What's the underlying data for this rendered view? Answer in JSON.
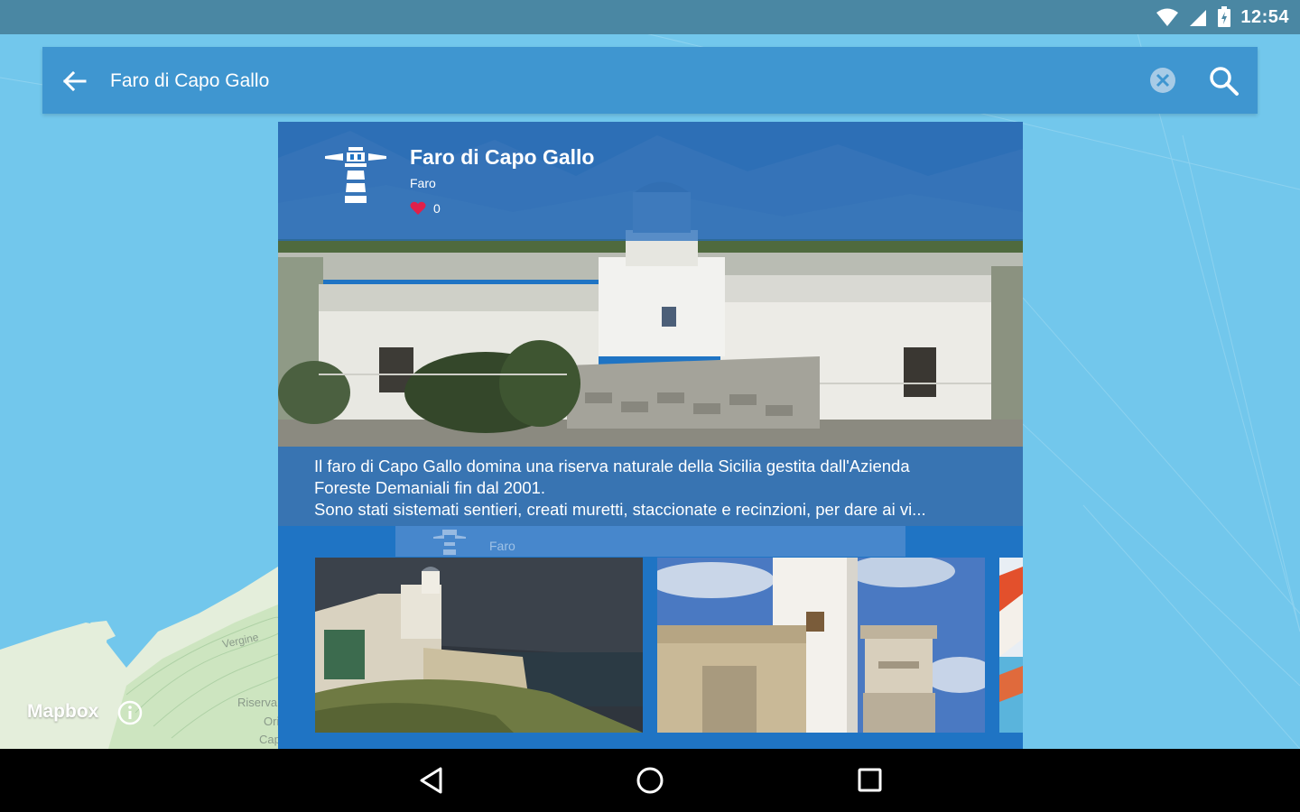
{
  "status_bar": {
    "time": "12:54",
    "icons": [
      "wifi-icon",
      "signal-icon",
      "battery-icon"
    ]
  },
  "search": {
    "query": "Faro di Capo Gallo",
    "icons": [
      "back-arrow-icon",
      "clear-icon",
      "search-icon"
    ]
  },
  "poi": {
    "title": "Faro di Capo Gallo",
    "category": "Faro",
    "likes": "0",
    "icon": "lighthouse-icon",
    "description": "Il faro di Capo Gallo domina una riserva naturale della Sicilia gestita dall'Azienda\nForeste Demaniali fin dal 2001.\nSono stati sistemati sentieri, creati muretti, staccionate e recinzioni, per dare ai vi...",
    "next_card_category": "Faro"
  },
  "map": {
    "attribution": "Mapbox",
    "labels": [
      "Vergine",
      "Riserva Na",
      "Orienta",
      "Capo Gallo"
    ]
  },
  "nav_bar": {
    "buttons": [
      "back-icon",
      "home-icon",
      "recents-icon"
    ]
  },
  "colors": {
    "status_bar": "#4a87a3",
    "search_bar": "#3f96d0",
    "card": "#1f74c4",
    "water": "#72c7ec",
    "heart": "#e0204a"
  }
}
